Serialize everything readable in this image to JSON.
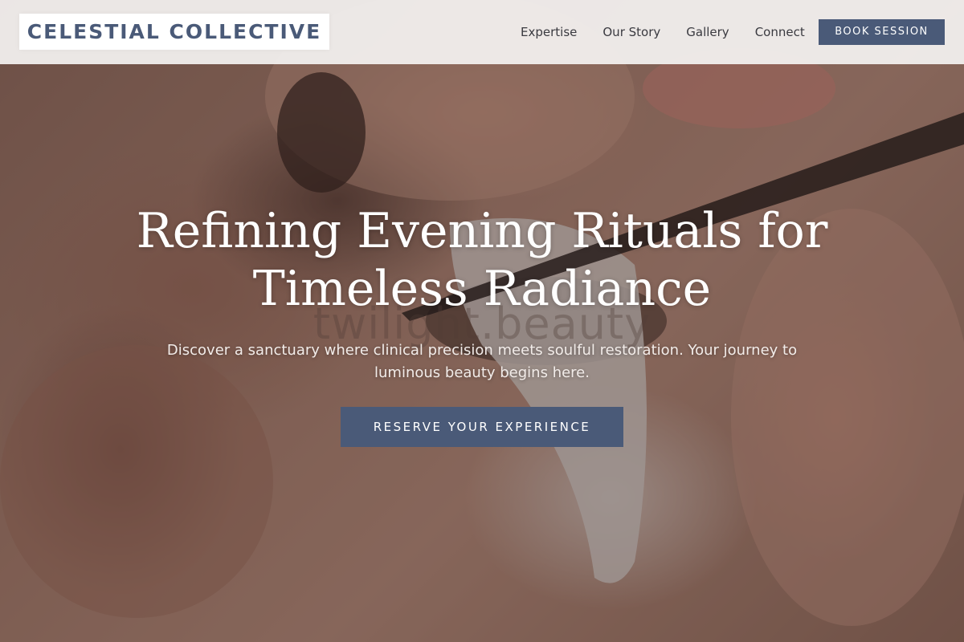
{
  "header": {
    "logo_text": "CELESTIAL COLLECTIVE",
    "nav": [
      {
        "label": "Expertise"
      },
      {
        "label": "Our Story"
      },
      {
        "label": "Gallery"
      },
      {
        "label": "Connect"
      }
    ],
    "book_button_label": "BOOK SESSION"
  },
  "hero": {
    "title": "Refining Evening Rituals for Timeless Radiance",
    "watermark_text": "twilight.beauty",
    "subtitle": "Discover a sanctuary where clinical precision meets soulful restoration. Your journey to luminous beauty begins here.",
    "cta_label": "RESERVE YOUR EXPERIENCE",
    "background_subject": "lash-application-photo"
  },
  "colors": {
    "accent": "#4a5a78",
    "header_bg": "#f4f2f1",
    "text_light": "#ffffff",
    "nav_text": "#3a3a40"
  }
}
